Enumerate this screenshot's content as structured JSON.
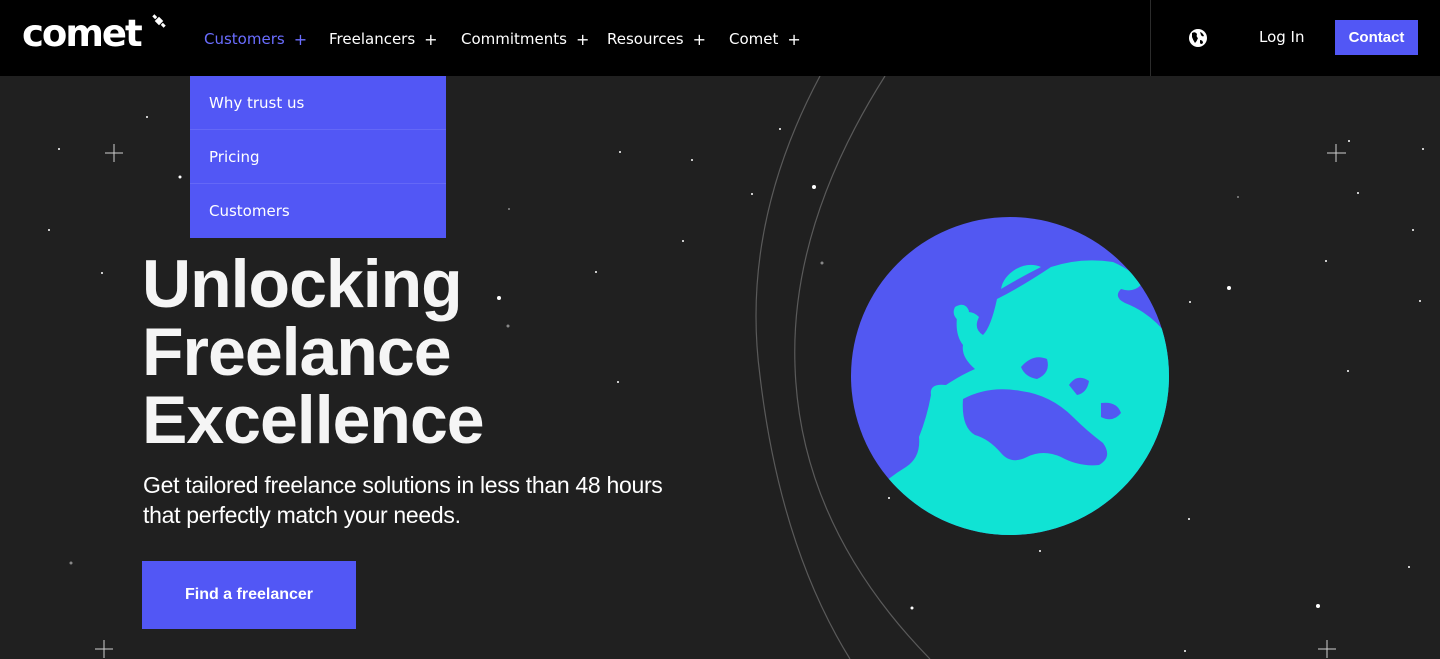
{
  "brand": {
    "logo_text": "comet"
  },
  "nav": {
    "items": [
      {
        "label": "Customers",
        "active": true
      },
      {
        "label": "Freelancers",
        "active": false
      },
      {
        "label": "Commitments",
        "active": false
      },
      {
        "label": "Resources",
        "active": false
      },
      {
        "label": "Comet",
        "active": false
      }
    ],
    "plus": "+"
  },
  "header": {
    "login_label": "Log In",
    "contact_label": "Contact",
    "language_icon": "globe-icon"
  },
  "dropdown": {
    "items": [
      {
        "label": "Why trust us"
      },
      {
        "label": "Pricing"
      },
      {
        "label": "Customers"
      }
    ]
  },
  "hero": {
    "title_lines": [
      "Unlocking",
      "Freelance",
      "Excellence"
    ],
    "subtitle": "Get tailored freelance solutions in less than 48 hours that perfectly match your needs.",
    "cta_label": "Find a freelancer"
  },
  "colors": {
    "background": "#202020",
    "topbar": "#000000",
    "accent": "#5257f5",
    "active_nav": "#6a6dff",
    "earth_ocean": "#5258f2",
    "earth_land": "#10e3d4"
  }
}
